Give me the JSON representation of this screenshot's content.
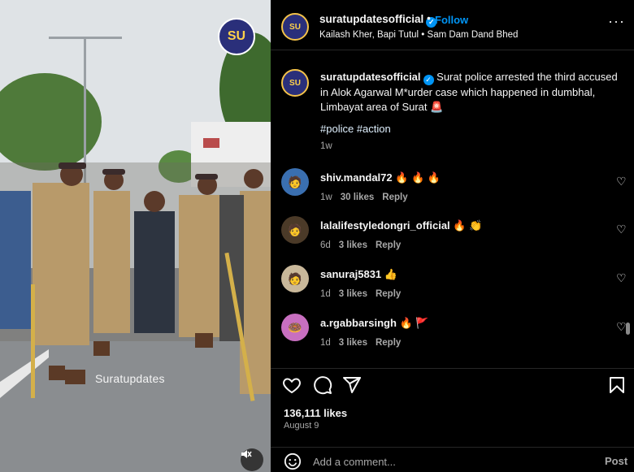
{
  "media": {
    "watermark": "Suratupdates",
    "logo_text": "SU",
    "mute_icon": "muted-speaker-icon"
  },
  "header": {
    "username": "suratupdatesofficial",
    "follow_label": "Follow",
    "dot": "•",
    "audio": "Kailash Kher, Bapi Tutul • Sam Dam Dand Bhed",
    "more_icon": "more-options-icon"
  },
  "caption": {
    "username": "suratupdatesofficial",
    "text": "Surat police arrested the third accused in Alok Agarwal M*urder case which happened in dumbhal, Limbayat area of Surat 🚨",
    "hashtags": [
      "#police",
      "#action"
    ],
    "time": "1w"
  },
  "comments": [
    {
      "username": "shiv.mandal72",
      "text": "🔥 🔥 🔥",
      "time": "1w",
      "likes": "30 likes",
      "reply": "Reply"
    },
    {
      "username": "lalalifestyledongri_official",
      "text": "🔥 👏",
      "time": "6d",
      "likes": "3 likes",
      "reply": "Reply"
    },
    {
      "username": "sanuraj5831",
      "text": "👍",
      "time": "1d",
      "likes": "3 likes",
      "reply": "Reply"
    },
    {
      "username": "a.rgabbarsingh",
      "text": "🔥 🚩",
      "time": "1d",
      "likes": "3 likes",
      "reply": "Reply"
    }
  ],
  "actions": {
    "likes": "136,111 likes",
    "date": "August 9"
  },
  "composer": {
    "placeholder": "Add a comment...",
    "post_label": "Post"
  },
  "colors": {
    "accent": "#0095f6",
    "background": "#000000",
    "muted_text": "#a8a8a8"
  }
}
